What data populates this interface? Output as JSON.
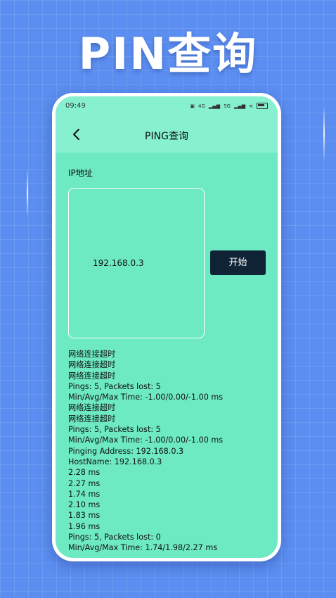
{
  "banner": {
    "title": "PIN查询"
  },
  "statusbar": {
    "time": "09:49",
    "signal_a": "4G",
    "signal_b": "5G"
  },
  "navbar": {
    "title": "PING查询"
  },
  "form": {
    "ip_label": "IP地址",
    "ip_value": "192.168.0.3",
    "start_label": "开始"
  },
  "log": [
    "网络连接超时",
    "网络连接超时",
    "网络连接超时",
    "Pings: 5, Packets lost: 5",
    "Min/Avg/Max Time: -1.00/0.00/-1.00 ms",
    "网络连接超时",
    "网络连接超时",
    "Pings: 5, Packets lost: 5",
    "Min/Avg/Max Time: -1.00/0.00/-1.00 ms",
    "Pinging Address: 192.168.0.3",
    "HostName: 192.168.0.3",
    "2.28 ms",
    "2.27 ms",
    "1.74 ms",
    "2.10 ms",
    "1.83 ms",
    "1.96 ms",
    "Pings: 5, Packets lost: 0",
    "Min/Avg/Max Time: 1.74/1.98/2.27 ms"
  ],
  "colors": {
    "background": "#5b8ef0",
    "screen": "#6de9c4",
    "header": "#86f0d0",
    "button": "#0f2236"
  }
}
